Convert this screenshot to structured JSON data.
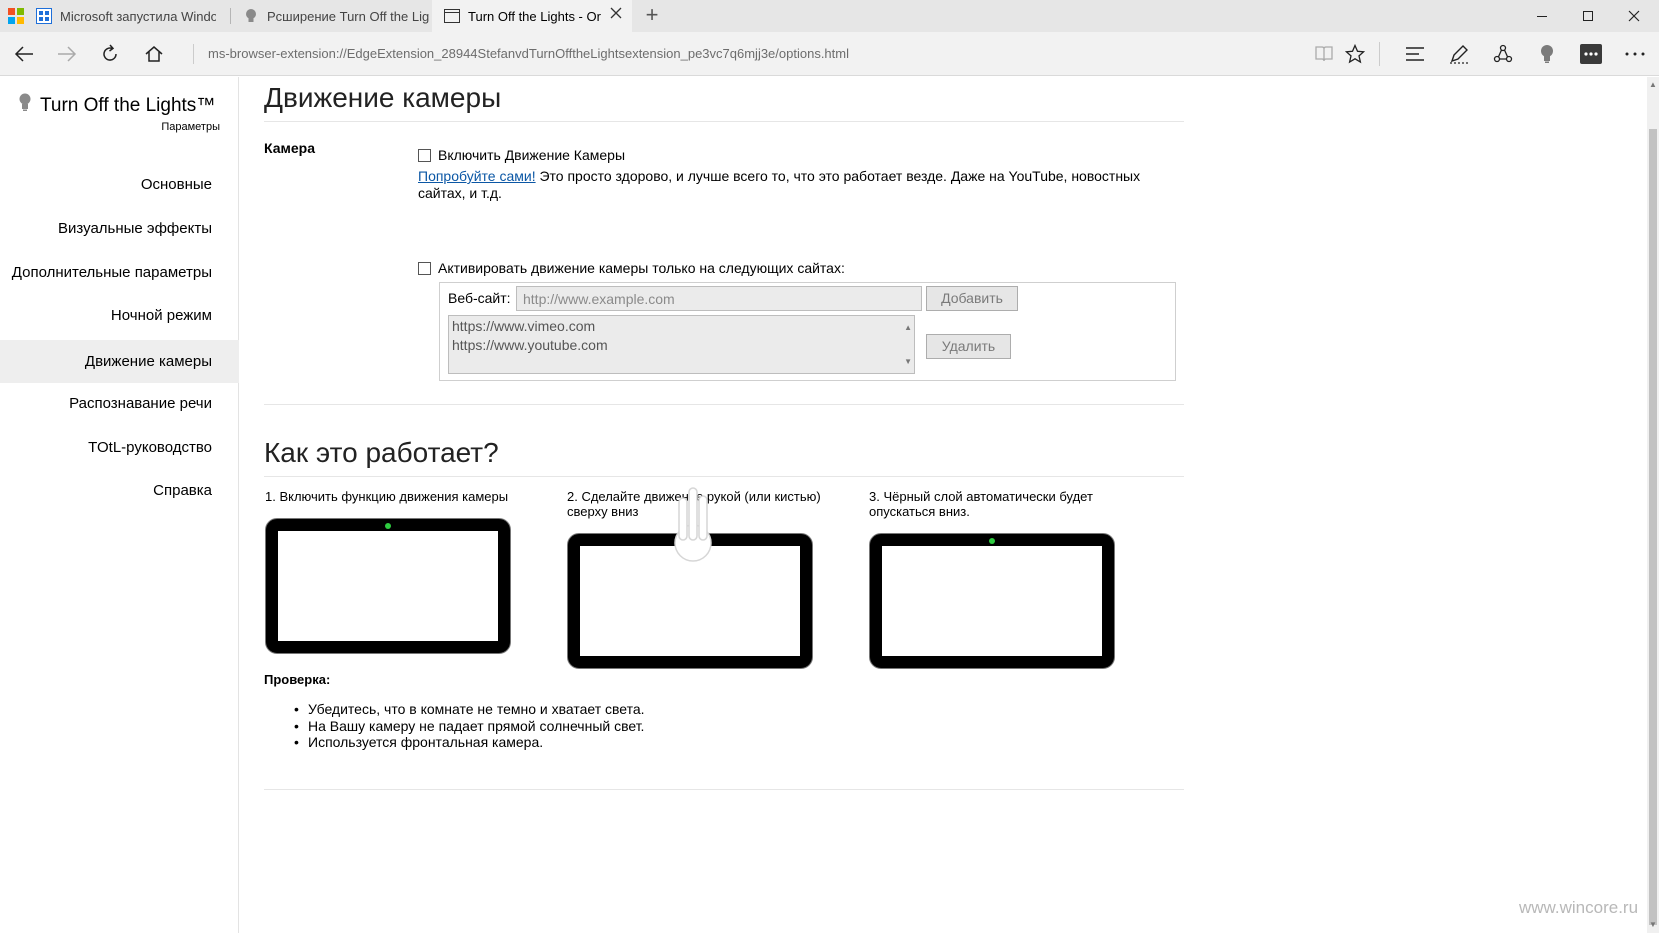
{
  "browser": {
    "tabs": [
      {
        "title": "Microsoft запустила Windo",
        "icon": "store-icon"
      },
      {
        "title": "Рсширение Turn Off the Lig",
        "icon": "bulb-icon"
      },
      {
        "title": "Turn Off the Lights - Or",
        "icon": "page-icon",
        "active": true
      }
    ],
    "address": "ms-browser-extension://EdgeExtension_28944StefanvdTurnOfftheLightsextension_pe3vc7q6mjj3e/options.html"
  },
  "sidebar": {
    "brand": "Turn Off the Lights™",
    "subtitle": "Параметры",
    "items": [
      {
        "label": "Основные"
      },
      {
        "label": "Визуальные эффекты"
      },
      {
        "label": "Дополнительные параметры"
      },
      {
        "label": "Ночной режим"
      },
      {
        "label": "Движение камеры",
        "selected": true
      },
      {
        "label": "Распознавание речи"
      },
      {
        "label": "TOtL-руководство"
      },
      {
        "label": "Справка"
      }
    ]
  },
  "main": {
    "title": "Движение камеры",
    "camera_label": "Камера",
    "enable_label": "Включить Движение Камеры",
    "enable_checked": false,
    "try_link": "Попробуйте сами!",
    "try_text": " Это просто здорово, и лучше всего то, что это работает везде. Даже на YouTube, новостных сайтах, и т.д.",
    "only_sites_label": "Активировать движение камеры только на следующих сайтах:",
    "only_sites_checked": false,
    "site_label": "Веб-сайт:",
    "site_placeholder": "http://www.example.com",
    "add_button": "Добавить",
    "remove_button": "Удалить",
    "sites": [
      "https://www.vimeo.com",
      "https://www.youtube.com"
    ]
  },
  "how": {
    "title": "Как это работает?",
    "steps": [
      "1. Включить функцию движения камеры",
      "2. Сделайте движение рукой (или кистью) сверху вниз",
      "3. Чёрный слой автоматически будет опускаться вниз."
    ],
    "check_title": "Проверка:",
    "checks": [
      "Убедитесь, что в комнате не темно и хватает света.",
      "На Вашу камеру не падает прямой солнечный свет.",
      "Используется фронтальная камера."
    ]
  },
  "watermark": "www.wincore.ru",
  "colors": {
    "link": "#0b57a5",
    "led": "#2ecc40",
    "selected_bg": "#eeeeee"
  }
}
